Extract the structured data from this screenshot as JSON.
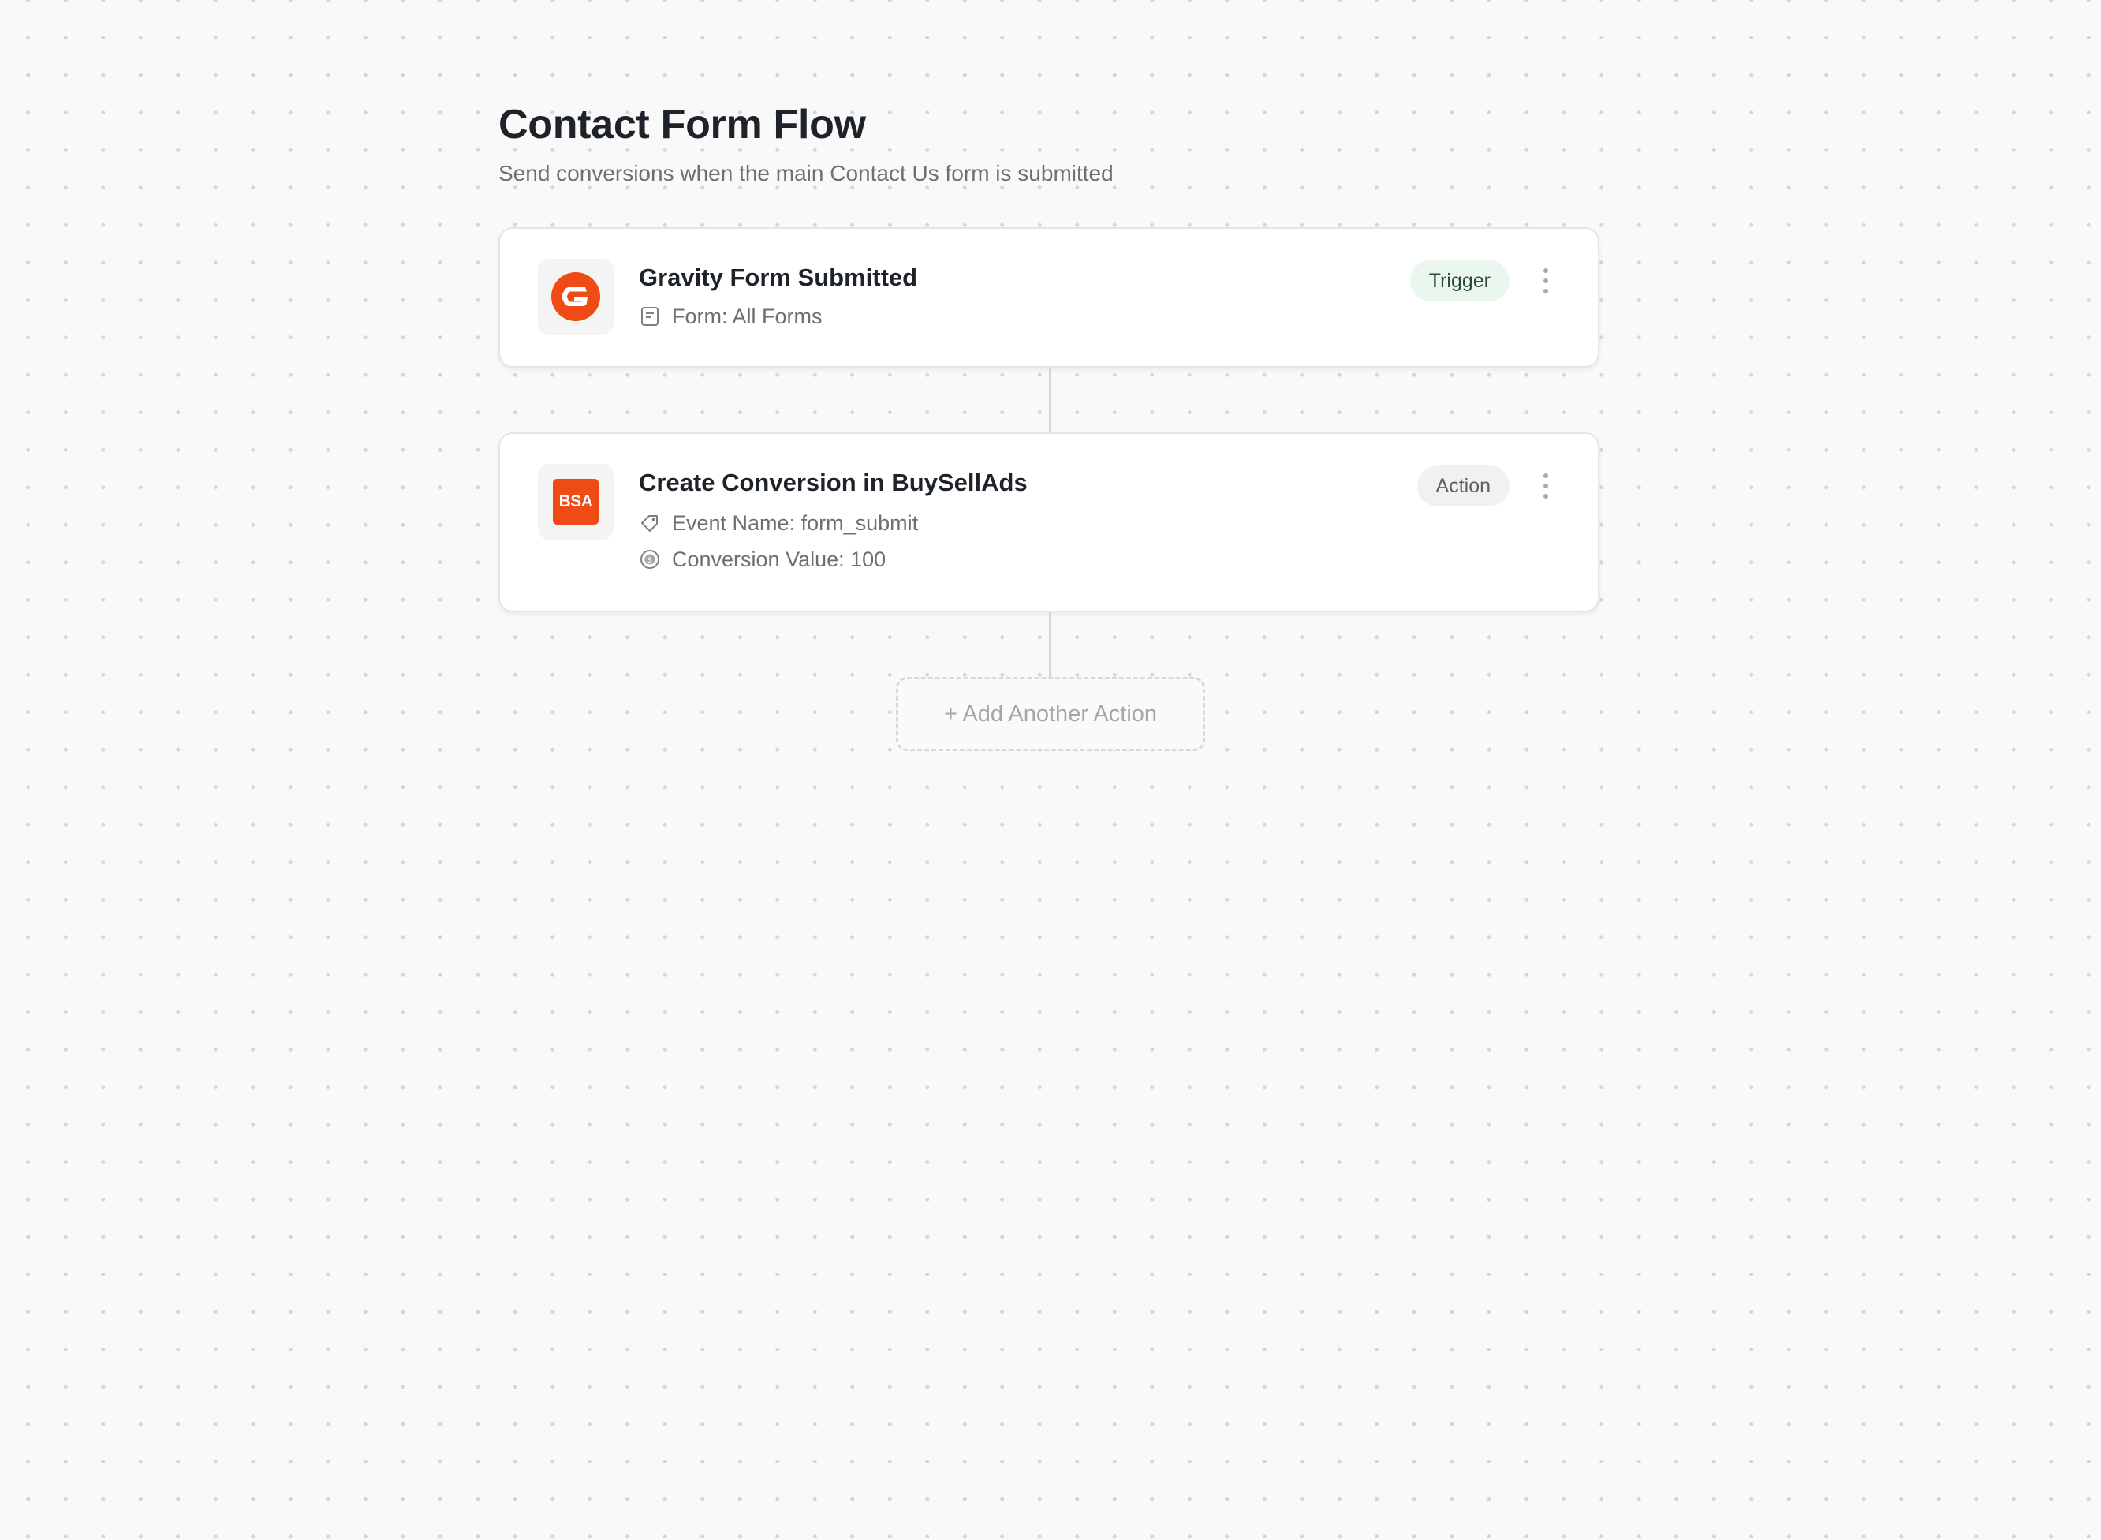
{
  "flow": {
    "title": "Contact Form Flow",
    "subtitle": "Send conversions when the main Contact Us form is submitted"
  },
  "steps": [
    {
      "title": "Gravity Form Submitted",
      "badge": "Trigger",
      "logo": "gravity-forms-logo",
      "details": [
        {
          "icon": "form-icon",
          "text": "Form: All Forms"
        }
      ]
    },
    {
      "title": "Create Conversion in BuySellAds",
      "badge": "Action",
      "logo": "buysellads-logo",
      "logo_text": "BSA",
      "details": [
        {
          "icon": "tag-icon",
          "text": "Event Name: form_submit"
        },
        {
          "icon": "dollar-circle-icon",
          "text": "Conversion Value: 100"
        }
      ]
    }
  ],
  "add_action": {
    "label": "+ Add Another Action"
  },
  "colors": {
    "brand_orange": "#ef4b14",
    "trigger_badge_bg": "#eaf6ee",
    "action_badge_bg": "#f1f1f2"
  }
}
